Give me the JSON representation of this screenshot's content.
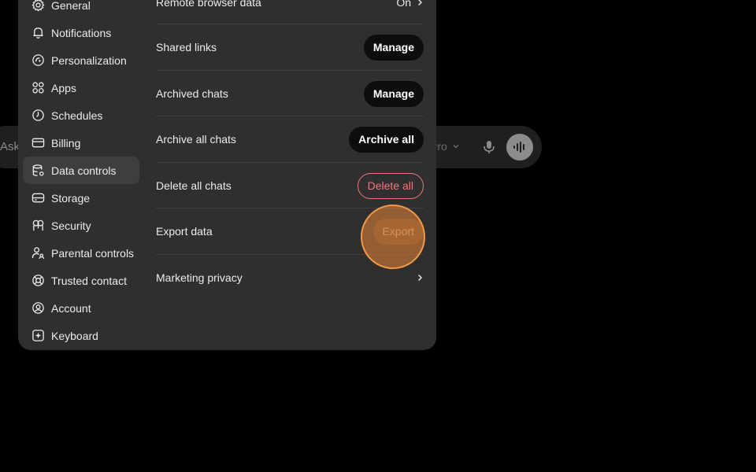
{
  "composer": {
    "placeholder": "Ask anything",
    "model_label": "Pro"
  },
  "sidebar": {
    "items": [
      {
        "label": "General",
        "icon": "gear-icon"
      },
      {
        "label": "Notifications",
        "icon": "bell-icon"
      },
      {
        "label": "Personalization",
        "icon": "personalization-icon"
      },
      {
        "label": "Apps",
        "icon": "apps-grid-icon"
      },
      {
        "label": "Schedules",
        "icon": "clock-icon"
      },
      {
        "label": "Billing",
        "icon": "credit-card-icon"
      },
      {
        "label": "Data controls",
        "icon": "database-icon",
        "active": true
      },
      {
        "label": "Storage",
        "icon": "storage-drive-icon"
      },
      {
        "label": "Security",
        "icon": "security-icon"
      },
      {
        "label": "Parental controls",
        "icon": "parental-icon"
      },
      {
        "label": "Trusted contact",
        "icon": "lifebuoy-icon"
      },
      {
        "label": "Account",
        "icon": "account-icon"
      },
      {
        "label": "Keyboard",
        "icon": "keyboard-icon"
      }
    ]
  },
  "content": {
    "rows": [
      {
        "label": "Remote browser data",
        "value": "On"
      },
      {
        "label": "Shared links",
        "button": "Manage"
      },
      {
        "label": "Archived chats",
        "button": "Manage"
      },
      {
        "label": "Archive all chats",
        "button": "Archive all"
      },
      {
        "label": "Delete all chats",
        "button": "Delete all"
      },
      {
        "label": "Export data",
        "button": "Export"
      },
      {
        "label": "Marketing privacy"
      }
    ]
  },
  "colors": {
    "modal_bg": "#2f2f2f",
    "danger": "#f0787d",
    "highlight": "#f39a45"
  }
}
